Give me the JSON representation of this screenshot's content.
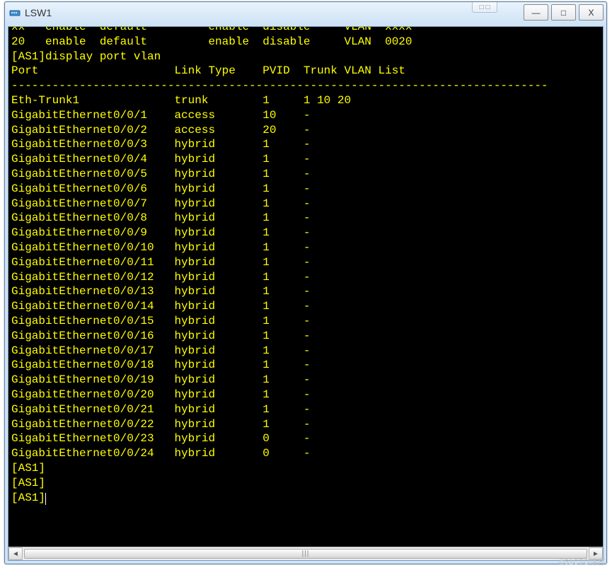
{
  "window": {
    "title": "LSW1",
    "icon_name": "device-icon"
  },
  "buttons": {
    "min_glyph": "—",
    "max_glyph": "□",
    "close_glyph": "X",
    "extra_glyph": "□ □"
  },
  "scrollbar": {
    "left_glyph": "◄",
    "right_glyph": "►",
    "grip_glyph": "|||"
  },
  "watermark": "©51CTO博客",
  "terminal": {
    "top_partial_1": "xx   enable  default         enable  disable     VLAN  xxxx",
    "vlan_line": "20   enable  default         enable  disable     VLAN  0020",
    "cmd_prompt": "[AS1]display port vlan",
    "header": "Port                    Link Type    PVID  Trunk VLAN List",
    "divider": "-------------------------------------------------------------------------------",
    "rows": [
      {
        "port": "Eth-Trunk1",
        "link": "trunk",
        "pvid": "1",
        "vlans": "1 10 20"
      },
      {
        "port": "GigabitEthernet0/0/1",
        "link": "access",
        "pvid": "10",
        "vlans": "-"
      },
      {
        "port": "GigabitEthernet0/0/2",
        "link": "access",
        "pvid": "20",
        "vlans": "-"
      },
      {
        "port": "GigabitEthernet0/0/3",
        "link": "hybrid",
        "pvid": "1",
        "vlans": "-"
      },
      {
        "port": "GigabitEthernet0/0/4",
        "link": "hybrid",
        "pvid": "1",
        "vlans": "-"
      },
      {
        "port": "GigabitEthernet0/0/5",
        "link": "hybrid",
        "pvid": "1",
        "vlans": "-"
      },
      {
        "port": "GigabitEthernet0/0/6",
        "link": "hybrid",
        "pvid": "1",
        "vlans": "-"
      },
      {
        "port": "GigabitEthernet0/0/7",
        "link": "hybrid",
        "pvid": "1",
        "vlans": "-"
      },
      {
        "port": "GigabitEthernet0/0/8",
        "link": "hybrid",
        "pvid": "1",
        "vlans": "-"
      },
      {
        "port": "GigabitEthernet0/0/9",
        "link": "hybrid",
        "pvid": "1",
        "vlans": "-"
      },
      {
        "port": "GigabitEthernet0/0/10",
        "link": "hybrid",
        "pvid": "1",
        "vlans": "-"
      },
      {
        "port": "GigabitEthernet0/0/11",
        "link": "hybrid",
        "pvid": "1",
        "vlans": "-"
      },
      {
        "port": "GigabitEthernet0/0/12",
        "link": "hybrid",
        "pvid": "1",
        "vlans": "-"
      },
      {
        "port": "GigabitEthernet0/0/13",
        "link": "hybrid",
        "pvid": "1",
        "vlans": "-"
      },
      {
        "port": "GigabitEthernet0/0/14",
        "link": "hybrid",
        "pvid": "1",
        "vlans": "-"
      },
      {
        "port": "GigabitEthernet0/0/15",
        "link": "hybrid",
        "pvid": "1",
        "vlans": "-"
      },
      {
        "port": "GigabitEthernet0/0/16",
        "link": "hybrid",
        "pvid": "1",
        "vlans": "-"
      },
      {
        "port": "GigabitEthernet0/0/17",
        "link": "hybrid",
        "pvid": "1",
        "vlans": "-"
      },
      {
        "port": "GigabitEthernet0/0/18",
        "link": "hybrid",
        "pvid": "1",
        "vlans": "-"
      },
      {
        "port": "GigabitEthernet0/0/19",
        "link": "hybrid",
        "pvid": "1",
        "vlans": "-"
      },
      {
        "port": "GigabitEthernet0/0/20",
        "link": "hybrid",
        "pvid": "1",
        "vlans": "-"
      },
      {
        "port": "GigabitEthernet0/0/21",
        "link": "hybrid",
        "pvid": "1",
        "vlans": "-"
      },
      {
        "port": "GigabitEthernet0/0/22",
        "link": "hybrid",
        "pvid": "1",
        "vlans": "-"
      },
      {
        "port": "GigabitEthernet0/0/23",
        "link": "hybrid",
        "pvid": "0",
        "vlans": "-"
      },
      {
        "port": "GigabitEthernet0/0/24",
        "link": "hybrid",
        "pvid": "0",
        "vlans": "-"
      }
    ],
    "prompts": [
      "[AS1]",
      "[AS1]",
      "[AS1]"
    ]
  }
}
